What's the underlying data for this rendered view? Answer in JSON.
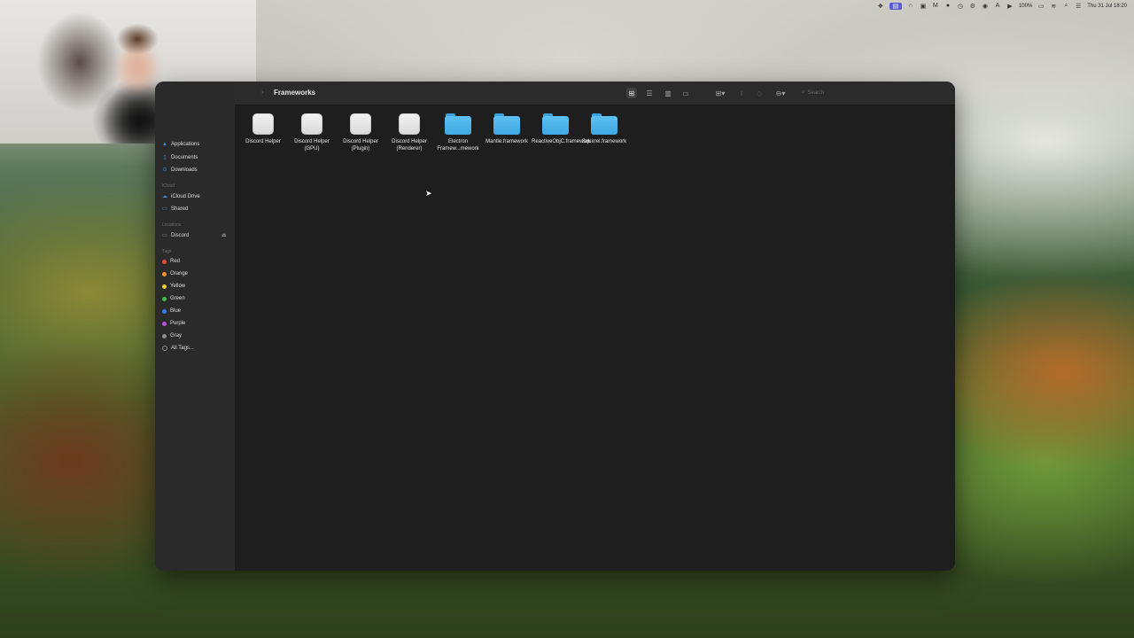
{
  "menubar": {
    "battery": "100%",
    "datetime": "Thu 31 Jul 18:20",
    "icons": [
      "dropbox-icon",
      "screen-record-icon",
      "headphones-icon",
      "screenshot-icon",
      "mail-icon",
      "record-dot-icon",
      "timer-icon",
      "settings-icon",
      "vpn-icon",
      "font-icon",
      "play-icon",
      "wifi-icon",
      "search-icon",
      "control-center-icon"
    ]
  },
  "window": {
    "title": "Frameworks",
    "search_placeholder": "Search"
  },
  "sidebar": {
    "partial_item": "Applications",
    "favorites": [
      {
        "label": "Documents",
        "icon": "document-icon"
      },
      {
        "label": "Downloads",
        "icon": "download-icon"
      }
    ],
    "icloud_header": "iCloud",
    "icloud": [
      {
        "label": "iCloud Drive",
        "icon": "cloud-icon"
      },
      {
        "label": "Shared",
        "icon": "shared-folder-icon"
      }
    ],
    "locations_header": "Locations",
    "locations": [
      {
        "label": "Discord",
        "icon": "disk-icon"
      }
    ],
    "tags_header": "Tags",
    "tags": [
      {
        "label": "Red",
        "color": "#e5483d"
      },
      {
        "label": "Orange",
        "color": "#f0932b"
      },
      {
        "label": "Yellow",
        "color": "#f2cf2a"
      },
      {
        "label": "Green",
        "color": "#3dbb4a"
      },
      {
        "label": "Blue",
        "color": "#2f7ef0"
      },
      {
        "label": "Purple",
        "color": "#b655d9"
      },
      {
        "label": "Gray",
        "color": "#8e8e93"
      },
      {
        "label": "All Tags...",
        "color": ""
      }
    ]
  },
  "files": [
    {
      "label": "Discord Helper",
      "kind": "app"
    },
    {
      "label": "Discord Helper (GPU)",
      "kind": "app"
    },
    {
      "label": "Discord Helper (Plugin)",
      "kind": "app"
    },
    {
      "label": "Discord Helper (Renderer)",
      "kind": "app"
    },
    {
      "label": "Electron Framew...mework",
      "kind": "folder"
    },
    {
      "label": "Mantle.framework",
      "kind": "folder"
    },
    {
      "label": "ReactiveObjC.framework",
      "kind": "folder"
    },
    {
      "label": "Squirrel.framework",
      "kind": "folder"
    }
  ]
}
